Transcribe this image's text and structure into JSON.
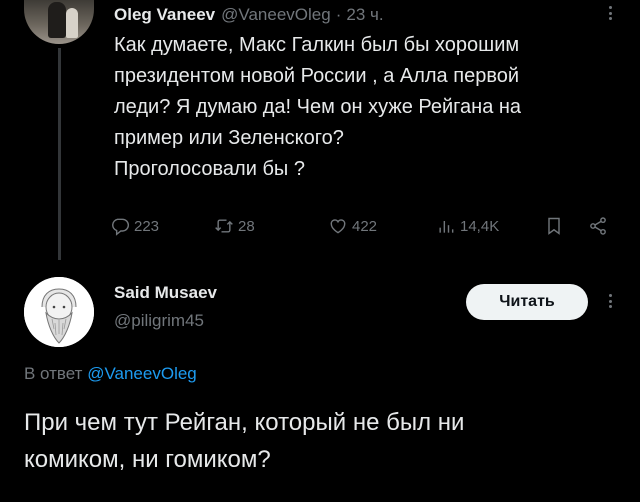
{
  "tweet": {
    "author_name": "Oleg Vaneev",
    "handle": "@VaneevOleg",
    "separator": "·",
    "time": "23 ч.",
    "text_lines": [
      "Как думаете, Макс Галкин был бы хорошим",
      "президентом новой  России , а Алла первой",
      "леди? Я думаю да! Чем он хуже Рейгана на",
      "пример или Зеленского?",
      "Проголосовали бы ?"
    ],
    "stats": {
      "replies": "223",
      "retweets": "28",
      "likes": "422",
      "views": "14,4K"
    }
  },
  "reply": {
    "author_name": "Said Musaev",
    "handle": "@piligrim45",
    "follow_label": "Читать",
    "reply_to_prefix": "В ответ",
    "reply_to_handle": "@VaneevOleg",
    "text_lines": [
      "При чем тут Рейган, который не был ни",
      "комиком, ни гомиком?"
    ]
  },
  "colors": {
    "background": "#000000",
    "text": "#e7e9ea",
    "muted": "#71767b",
    "accent": "#1d9bf0",
    "button_bg": "#eff3f4"
  },
  "icons": {
    "reply": "reply-icon",
    "retweet": "retweet-icon",
    "like": "heart-icon",
    "views": "views-icon",
    "bookmark": "bookmark-icon",
    "share": "share-icon",
    "more": "more-icon"
  }
}
